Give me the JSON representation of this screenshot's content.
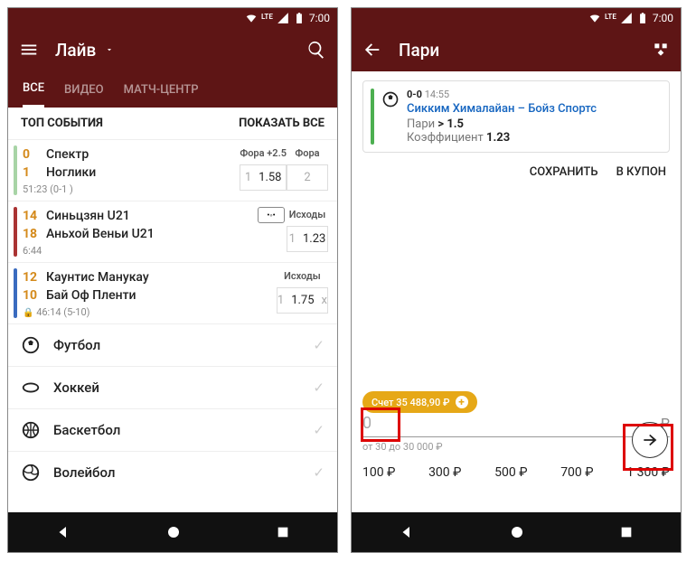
{
  "status": {
    "time": "7:00",
    "lte": "LTE"
  },
  "left": {
    "title": "Лайв",
    "tabs": [
      "ВСЕ",
      "ВИДЕО",
      "МАТЧ-ЦЕНТР"
    ],
    "section": {
      "title": "ТОП СОБЫТИЯ",
      "action": "ПОКАЗАТЬ ВСЕ"
    },
    "events": [
      {
        "s1": "0",
        "t1": "Спектр",
        "s2": "1",
        "t2": "Ноглики",
        "meta": "51:23 (0-1 )",
        "h1": "Фора +2.5",
        "h2": "Фора",
        "o_dim": "1",
        "o_val": "1.58",
        "o_dim2": "2"
      },
      {
        "s1": "14",
        "t1": "Синьцзян U21",
        "s2": "18",
        "t2": "Аньхой Веньи U21",
        "meta": "6:44",
        "h1": "Исходы",
        "o_dim": "1",
        "o_val": "1.23"
      },
      {
        "s1": "12",
        "t1": "Каунтис Манукау",
        "s2": "10",
        "t2": "Бай Оф Пленти",
        "meta": "46:14 (5-10)",
        "lock": "🔒",
        "h1": "Исходы",
        "o_dim": "1",
        "o_val": "1.75",
        "o_dim2": "x"
      }
    ],
    "sports": [
      "Футбол",
      "Хоккей",
      "Баскетбол",
      "Волейбол"
    ]
  },
  "right": {
    "title": "Пари",
    "card": {
      "score": "0-0",
      "time": "14:55",
      "match": "Сикким Хималайан – Бойз Спортс",
      "bet_label": "Пари",
      "bet_val": "> 1.5",
      "coef_label": "Коэффициент",
      "coef_val": "1.23"
    },
    "actions": {
      "save": "СОХРАНИТЬ",
      "coupon": "В КУПОН"
    },
    "balance": "Счет 35 488,90 ₽",
    "amount": {
      "placeholder": "0",
      "currency": "₽",
      "hint": "от 30 до 30 000 ₽"
    },
    "quick": [
      "100 ₽",
      "300 ₽",
      "500 ₽",
      "700 ₽",
      "1 300 ₽"
    ]
  }
}
